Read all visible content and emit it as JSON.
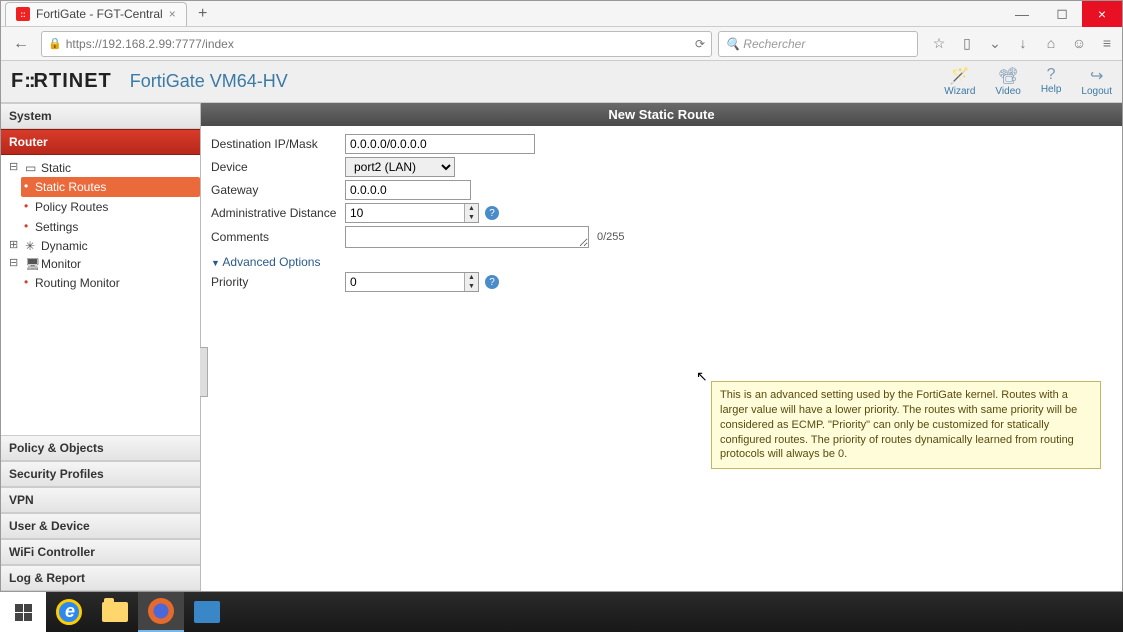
{
  "browser": {
    "tab_title": "FortiGate - FGT-Central",
    "url": "https://192.168.2.99:7777/index",
    "search_placeholder": "Rechercher"
  },
  "header": {
    "brand": "FORTINET",
    "model": "FortiGate VM64-HV",
    "actions": {
      "wizard": "Wizard",
      "video": "Video",
      "help": "Help",
      "logout": "Logout"
    }
  },
  "sidebar": {
    "sections": {
      "system": "System",
      "router": "Router",
      "policy": "Policy & Objects",
      "security": "Security Profiles",
      "vpn": "VPN",
      "user": "User & Device",
      "wifi": "WiFi Controller",
      "log": "Log & Report"
    },
    "tree": {
      "static": "Static",
      "static_routes": "Static Routes",
      "policy_routes": "Policy Routes",
      "settings": "Settings",
      "dynamic": "Dynamic",
      "monitor": "Monitor",
      "routing_monitor": "Routing Monitor"
    }
  },
  "panel": {
    "title": "New Static Route",
    "labels": {
      "dest": "Destination IP/Mask",
      "device": "Device",
      "gateway": "Gateway",
      "admin_dist": "Administrative Distance",
      "comments": "Comments",
      "advanced": "Advanced Options",
      "priority": "Priority"
    },
    "values": {
      "dest": "0.0.0.0/0.0.0.0",
      "device": "port2 (LAN)",
      "gateway": "0.0.0.0",
      "admin_dist": "10",
      "comments": "",
      "comment_counter": "0/255",
      "priority": "0"
    },
    "tooltip": "This is an advanced setting used by the FortiGate kernel. Routes with a larger value will have a lower priority. The routes with same priority will be considered as ECMP. \"Priority\" can only be customized for statically configured routes. The priority of routes dynamically learned from routing protocols will always be 0."
  }
}
